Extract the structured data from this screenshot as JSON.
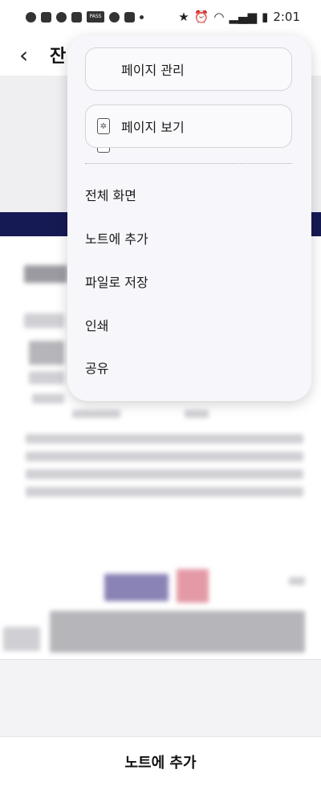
{
  "status_bar": {
    "time": "2:01",
    "left_icons": [
      "minus-circle-icon",
      "image-icon",
      "c-icon",
      "b-icon",
      "pass-icon",
      "c-icon",
      "tool-icon",
      "dot-icon"
    ],
    "right_icons": [
      "star-icon",
      "alarm-icon",
      "wifi-icon",
      "signal-icon",
      "battery-icon"
    ],
    "pass_label": "PASS"
  },
  "app_bar": {
    "back_icon": "chevron-left-icon",
    "title": "잔"
  },
  "menu": {
    "cards": [
      {
        "label": "페이지 관리",
        "icon": "document-icon"
      },
      {
        "label": "페이지 보기",
        "icon": "gear-icon"
      }
    ],
    "items": [
      {
        "label": "전체 화면"
      },
      {
        "label": "노트에 추가"
      },
      {
        "label": "파일로 저장"
      },
      {
        "label": "인쇄"
      },
      {
        "label": "공유"
      }
    ]
  },
  "bottom_bar": {
    "button_label": "노트에 추가"
  },
  "colors": {
    "band": "#161a54",
    "menu_bg": "#f7f7fb"
  }
}
